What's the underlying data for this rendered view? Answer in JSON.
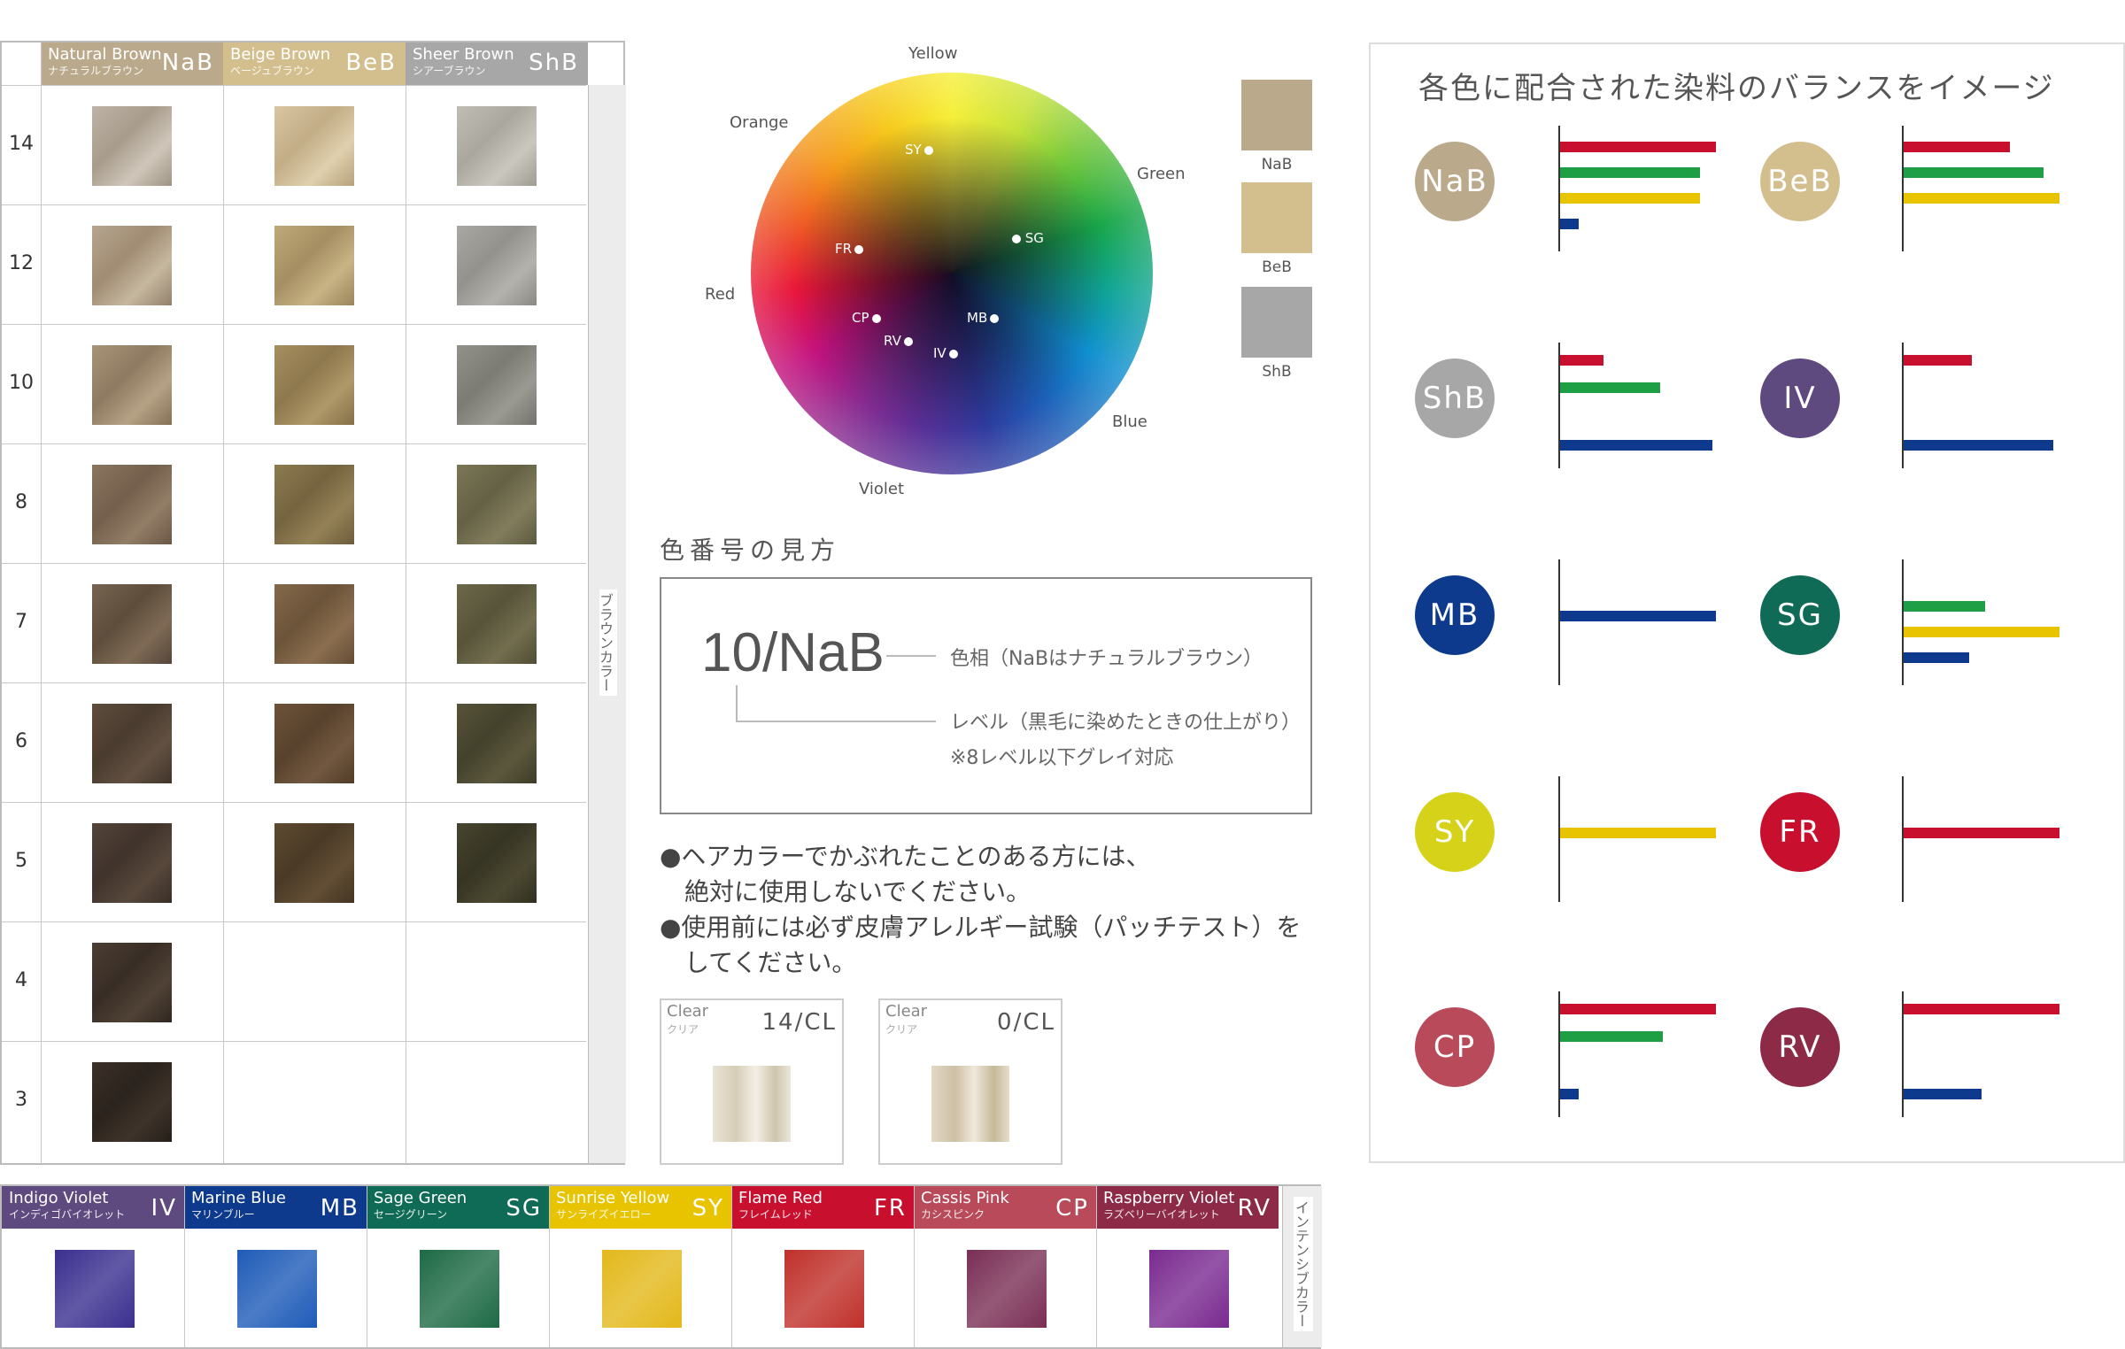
{
  "brown_table": {
    "columns": [
      {
        "en": "Natural Brown",
        "jp": "ナチュラルブラウン",
        "code": "NaB",
        "header_color": "#bba98c"
      },
      {
        "en": "Beige Brown",
        "jp": "ベージュブラウン",
        "code": "BeB",
        "header_color": "#d3bf8e"
      },
      {
        "en": "Sheer Brown",
        "jp": "シアーブラウン",
        "code": "ShB",
        "header_color": "#a7a7a7"
      }
    ],
    "levels": [
      "14",
      "12",
      "10",
      "8",
      "7",
      "6",
      "5",
      "4",
      "3"
    ],
    "side_label": "ブラウンカラー"
  },
  "color_wheel": {
    "labels": [
      "Yellow",
      "Green",
      "Blue",
      "Violet",
      "Red",
      "Orange"
    ],
    "points": [
      "SY",
      "SG",
      "FR",
      "CP",
      "MB",
      "RV",
      "IV"
    ]
  },
  "legend": [
    {
      "label": "NaB",
      "color": "#bba98c"
    },
    {
      "label": "BeB",
      "color": "#d3bf8e"
    },
    {
      "label": "ShB",
      "color": "#a7a7a7"
    }
  ],
  "howto": {
    "title": "色番号の見方",
    "code": "10/NaB",
    "hue_note": "色相（NaBはナチュラルブラウン）",
    "level_note": "レベル（黒毛に染めたときの仕上がり）",
    "gray_note": "※8レベル以下グレイ対応"
  },
  "warnings": [
    "●ヘアカラーでかぶれたことのある方には、",
    "　絶対に使用しないでください。",
    "●使用前には必ず皮膚アレルギー試験（パッチテスト）を",
    "　してください。"
  ],
  "clear": [
    {
      "en": "Clear",
      "jp": "クリア",
      "code": "14/CL"
    },
    {
      "en": "Clear",
      "jp": "クリア",
      "code": "0/CL"
    }
  ],
  "balance": {
    "title": "各色に配合された染料のバランスをイメージ",
    "bar_colors": {
      "red": "#c8102e",
      "green": "#1e9e45",
      "yellow": "#e8c400",
      "blue": "#0d3a8c"
    },
    "items": [
      {
        "code": "NaB",
        "color": "#bba98c",
        "bars": {
          "red": 1.0,
          "green": 0.9,
          "yellow": 0.9,
          "blue": 0.12
        }
      },
      {
        "code": "BeB",
        "color": "#d3bf8e",
        "bars": {
          "red": 0.68,
          "green": 0.9,
          "yellow": 1.0
        }
      },
      {
        "code": "ShB",
        "color": "#a7a7a7",
        "bars": {
          "red": 0.28,
          "green": 0.64,
          "blue": 0.98
        }
      },
      {
        "code": "IV",
        "color": "#5f4a7f",
        "bars": {
          "red": 0.44,
          "blue": 0.96
        }
      },
      {
        "code": "MB",
        "color": "#0d3a8c",
        "bars": {
          "blue": 1.0
        }
      },
      {
        "code": "SG",
        "color": "#0f6b55",
        "bars": {
          "green": 0.52,
          "yellow": 1.0,
          "blue": 0.42
        }
      },
      {
        "code": "SY",
        "color": "#d6d21a",
        "bars": {
          "yellow": 1.0
        }
      },
      {
        "code": "FR",
        "color": "#c8102e",
        "bars": {
          "red": 1.0
        }
      },
      {
        "code": "CP",
        "color": "#b94a5a",
        "bars": {
          "red": 1.0,
          "green": 0.66,
          "blue": 0.12
        }
      },
      {
        "code": "RV",
        "color": "#8c2a47",
        "bars": {
          "red": 1.0,
          "blue": 0.5
        }
      }
    ]
  },
  "intensive": {
    "items": [
      {
        "en": "Indigo Violet",
        "jp": "インディゴバイオレット",
        "code": "IV",
        "header_color": "#5f4a7f",
        "swatch": "#3a2f8f"
      },
      {
        "en": "Marine Blue",
        "jp": "マリンブルー",
        "code": "MB",
        "header_color": "#0d3a8c",
        "swatch": "#1e5bb8"
      },
      {
        "en": "Sage Green",
        "jp": "セージグリーン",
        "code": "SG",
        "header_color": "#0f6b55",
        "swatch": "#1d6a45"
      },
      {
        "en": "Sunrise Yellow",
        "jp": "サンライズイエロー",
        "code": "SY",
        "header_color": "#e8c400",
        "swatch": "#e3b81a"
      },
      {
        "en": "Flame Red",
        "jp": "フレイムレッド",
        "code": "FR",
        "header_color": "#c8102e",
        "swatch": "#c0302a"
      },
      {
        "en": "Cassis Pink",
        "jp": "カシスピンク",
        "code": "CP",
        "header_color": "#b94a5a",
        "swatch": "#7a2f55"
      },
      {
        "en": "Raspberry Violet",
        "jp": "ラズベリーバイオレット",
        "code": "RV",
        "header_color": "#8c2a47",
        "swatch": "#7a2a90"
      }
    ],
    "side_label": "インテンシブカラー"
  }
}
